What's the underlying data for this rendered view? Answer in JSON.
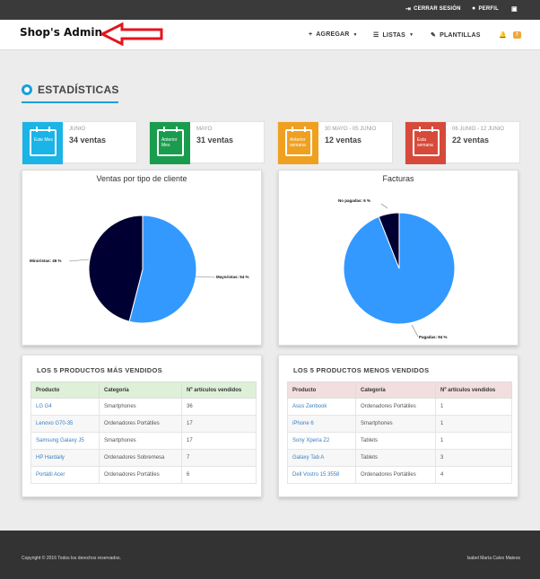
{
  "topbar": {
    "logout_label": "CERRAR SESIÓN",
    "profile_label": "PERFIL"
  },
  "navbar": {
    "brand": "Shop's Admin",
    "add_label": "AGREGAR",
    "lists_label": "LISTAS",
    "templates_label": "PLANTILLAS",
    "notifications_count": "7"
  },
  "stats_section": {
    "title": "ESTADÍSTICAS",
    "cards": [
      {
        "icon_text": "Este Mes",
        "period": "JUNIO",
        "count": "34 ventas",
        "color": "#1ab4e6"
      },
      {
        "icon_text": "Anterior Mes",
        "period": "MAYO",
        "count": "31 ventas",
        "color": "#1a9c4e"
      },
      {
        "icon_text": "Anterior semana",
        "period": "30 MAYO - 05 JUNIO",
        "count": "12 ventas",
        "color": "#f0a020"
      },
      {
        "icon_text": "Esta semana",
        "period": "06 JUNIO - 12 JUNIO",
        "count": "22 ventas",
        "color": "#d74a3b"
      }
    ]
  },
  "chart_data": [
    {
      "type": "pie",
      "title": "Ventas por tipo de cliente",
      "slices": [
        {
          "label": "Mayoristas: 54 %",
          "value": 54,
          "color": "#3399ff"
        },
        {
          "label": "Minoristas: 46 %",
          "value": 46,
          "color": "#000033"
        }
      ]
    },
    {
      "type": "pie",
      "title": "Facturas",
      "slices": [
        {
          "label": "Pagadas: 94 %",
          "value": 94,
          "color": "#3399ff"
        },
        {
          "label": "No pagadas: 6 %",
          "value": 6,
          "color": "#000033"
        }
      ]
    }
  ],
  "top_products": {
    "title": "LOS 5 PRODUCTOS MÁS VENDIDOS",
    "header_color": "#dff0d8",
    "columns": [
      "Producto",
      "Categoría",
      "Nº artículos vendidos"
    ],
    "rows": [
      [
        "LG G4",
        "Smartphones",
        "36"
      ],
      [
        "Lenovo G70-35",
        "Ordenadores Portátiles",
        "17"
      ],
      [
        "Samsung Galaxy J5",
        "Smartphones",
        "17"
      ],
      [
        "HP Hardaily",
        "Ordenadores Sobremesa",
        "7"
      ],
      [
        "Portátil Acer",
        "Ordenadores Portátiles",
        "6"
      ]
    ]
  },
  "bottom_products": {
    "title": "LOS 5 PRODUCTOS MENOS VENDIDOS",
    "header_color": "#f2dede",
    "columns": [
      "Producto",
      "Categoría",
      "Nº artículos vendidos"
    ],
    "rows": [
      [
        "Asus Zenbook",
        "Ordenadores Portátiles",
        "1"
      ],
      [
        "iPhone 6",
        "Smartphones",
        "1"
      ],
      [
        "Sony Xperia Z2",
        "Tablets",
        "1"
      ],
      [
        "Galaxy Tab A",
        "Tablets",
        "3"
      ],
      [
        "Dell Vostro 15 3558",
        "Ordenadores Portátiles",
        "4"
      ]
    ]
  },
  "footer": {
    "copyright": "Copyright © 2016 Todos los derechos reservados.",
    "author": "Isabel María Calvo Mateos"
  }
}
